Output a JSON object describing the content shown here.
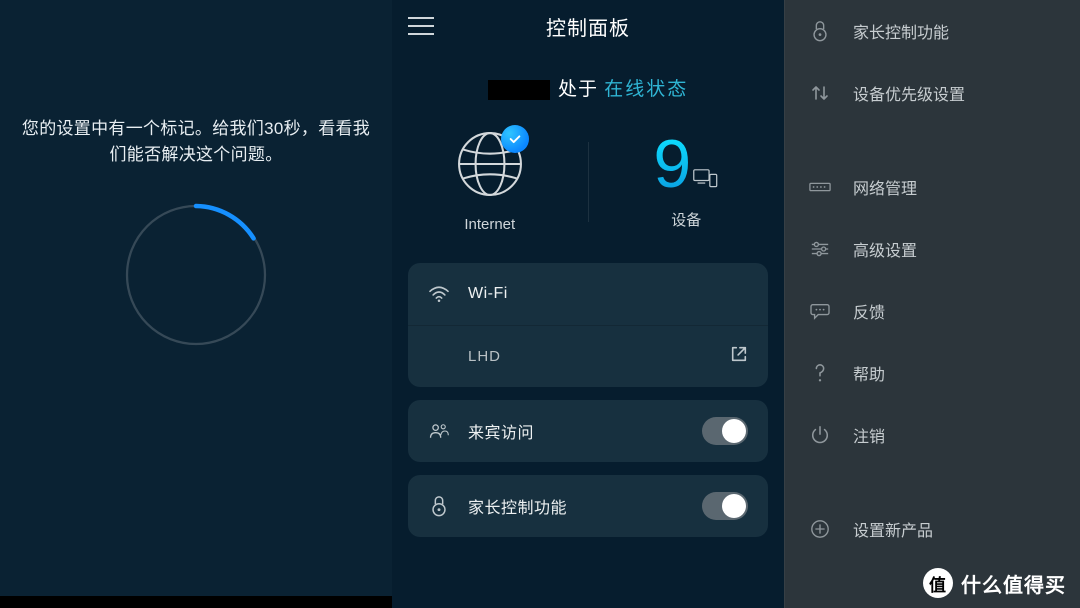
{
  "panel1": {
    "message": "您的设置中有一个标记。给我们30秒，看看我们能否解决这个问题。"
  },
  "panel2": {
    "header_title": "控制面板",
    "status_prefix": "处于 ",
    "status_value": "在线状态",
    "internet_label": "Internet",
    "device_count": "9",
    "device_label": "设备",
    "wifi_label": "Wi-Fi",
    "wifi_ssid": "LHD",
    "guest_label": "来宾访问",
    "parental_label": "家长控制功能",
    "guest_toggle": true,
    "parental_toggle": true
  },
  "panel3": {
    "items_top": [
      {
        "id": "parentalcontrol",
        "label": "家长控制功能",
        "icon": "lock"
      },
      {
        "id": "priority",
        "label": "设备优先级设置",
        "icon": "priority"
      }
    ],
    "items_mid": [
      {
        "id": "network",
        "label": "网络管理",
        "icon": "network"
      },
      {
        "id": "advanced",
        "label": "高级设置",
        "icon": "sliders"
      },
      {
        "id": "feedback",
        "label": "反馈",
        "icon": "chat"
      },
      {
        "id": "help",
        "label": "帮助",
        "icon": "help"
      },
      {
        "id": "logout",
        "label": "注销",
        "icon": "power"
      }
    ],
    "items_bottom": [
      {
        "id": "addproduct",
        "label": "设置新产品",
        "icon": "plus"
      }
    ]
  },
  "watermark": "什么值得买"
}
